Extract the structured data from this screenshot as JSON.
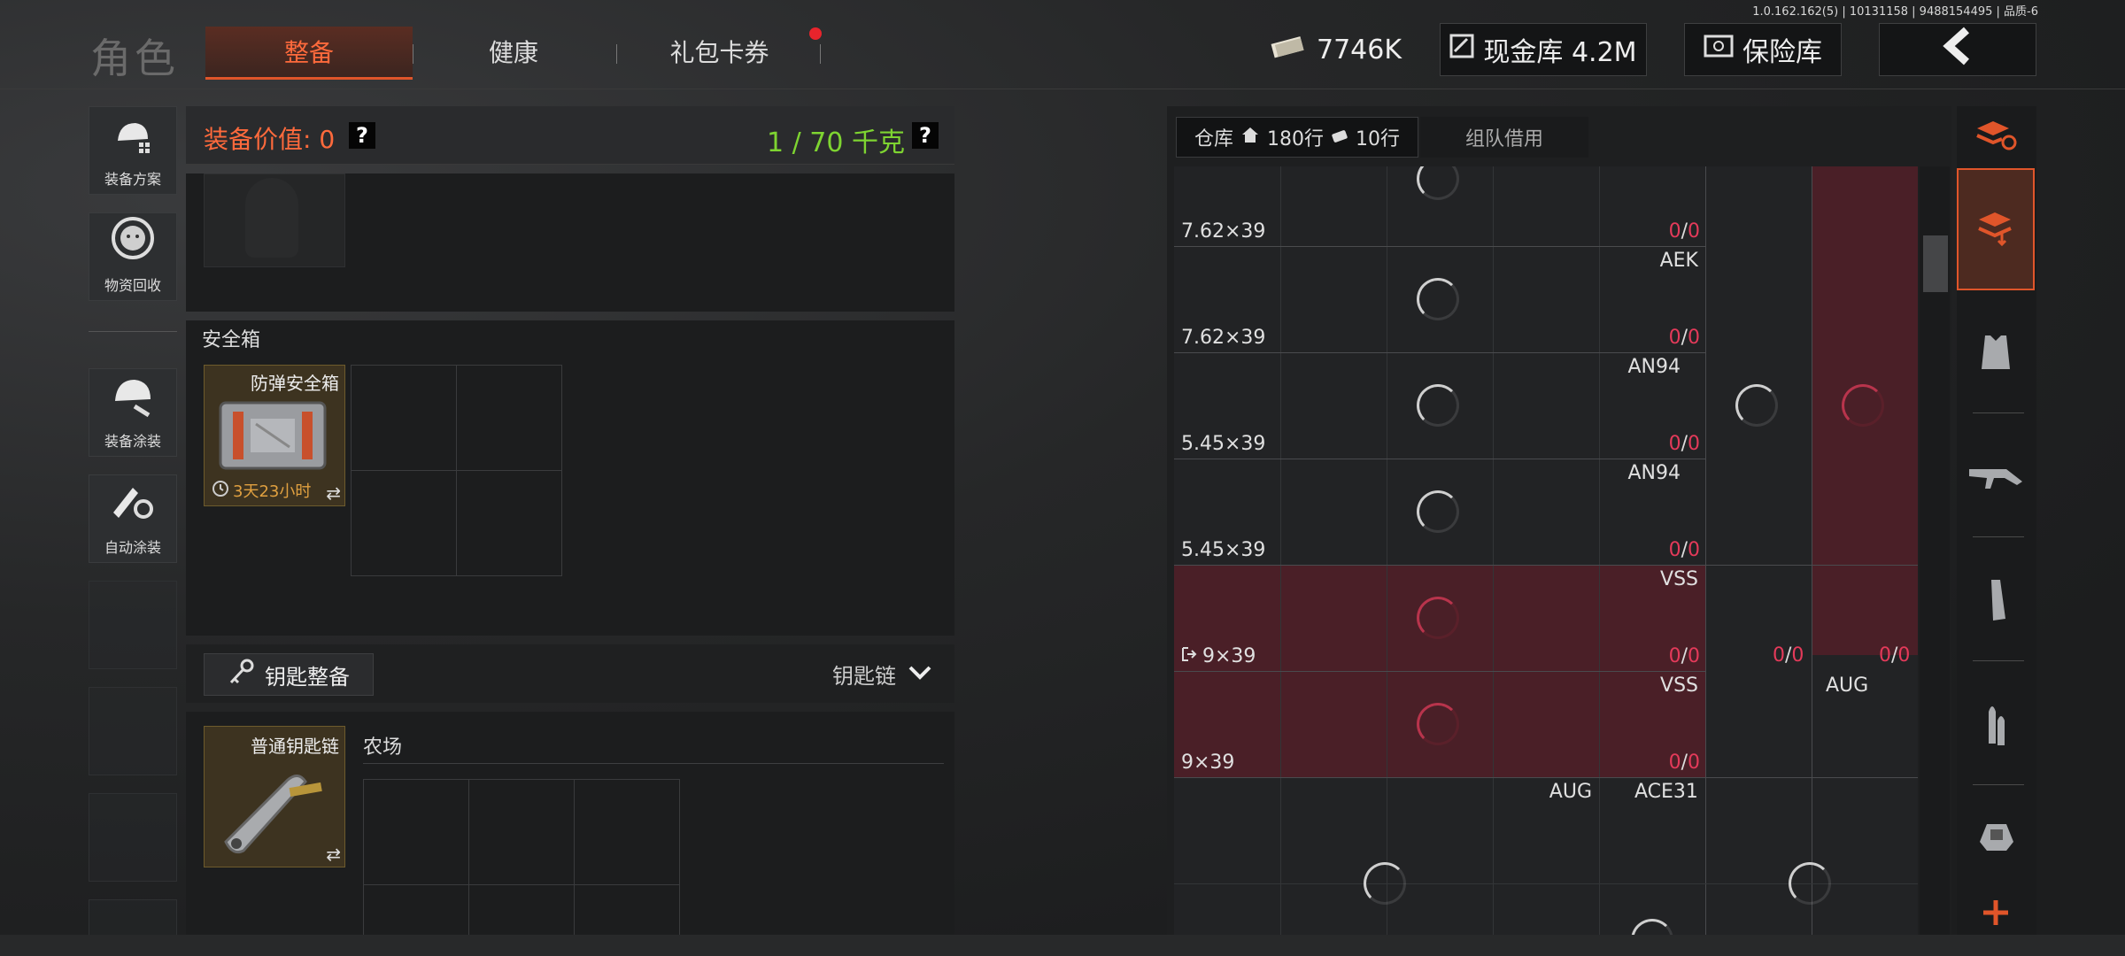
{
  "version": "1.0.162.162(5) | 10131158 | 9488154495 | 品质-6",
  "page_title": "角色",
  "tabs": [
    {
      "label": "整备",
      "active": true
    },
    {
      "label": "健康",
      "active": false
    },
    {
      "label": "礼包卡券",
      "active": false
    }
  ],
  "currency": {
    "money": "7746K",
    "cash_vault": "现金库 4.2M",
    "safe_vault": "保险库"
  },
  "side_buttons": [
    {
      "label": "装备方案",
      "icon": "loadout-plan-icon"
    },
    {
      "label": "物资回收",
      "icon": "recycle-icon"
    },
    {
      "label": "装备涂装",
      "icon": "helmet-paint-icon"
    },
    {
      "label": "自动涂装",
      "icon": "auto-paint-icon"
    }
  ],
  "equipment": {
    "value_label": "装备价值: 0",
    "help": "?",
    "weight": "1 / 70 千克"
  },
  "safe_box": {
    "title": "安全箱",
    "item_name": "防弹安全箱",
    "timer": "3天23小时"
  },
  "keys": {
    "button_label": "钥匙整备",
    "dropdown_label": "钥匙链",
    "item_name": "普通钥匙链",
    "location": "农场"
  },
  "warehouse": {
    "tab_label": "仓库",
    "rows": "180行",
    "rows_extra": "10行",
    "team_borrow": "组队借用",
    "slots": [
      {
        "label": "",
        "ammo": "7.62×39",
        "count_a": "0",
        "count_b": "0"
      },
      {
        "label": "AEK",
        "ammo": "7.62×39",
        "count_a": "0",
        "count_b": "0"
      },
      {
        "label": "AN94",
        "ammo": "5.45×39",
        "count_a": "0",
        "count_b": "0"
      },
      {
        "label": "AN94",
        "ammo": "5.45×39",
        "count_a": "0",
        "count_b": "0"
      },
      {
        "label": "VSS",
        "ammo": "9×39",
        "count_a": "0",
        "count_b": "0"
      },
      {
        "label": "VSS",
        "ammo": "9×39",
        "count_a": "0",
        "count_b": "0"
      }
    ],
    "extra": [
      {
        "label": "AUG",
        "count_a": "0",
        "count_b": "0"
      },
      {
        "label": "AUG"
      },
      {
        "label": "ACE31"
      }
    ],
    "col5_counts": [
      {
        "a": "0",
        "b": "0"
      },
      {
        "a": "0",
        "b": "0"
      }
    ]
  },
  "categories": [
    "refresh-stack-icon",
    "stack-sort-icon",
    "vest-icon",
    "rifle-icon",
    "magazine-icon",
    "ammo-icon",
    "scope-icon",
    "add-icon"
  ],
  "colors": {
    "accent": "#e0552a",
    "weight_green": "#7ed431",
    "danger": "#e43a5a",
    "red_bg": "#4a1f27"
  }
}
